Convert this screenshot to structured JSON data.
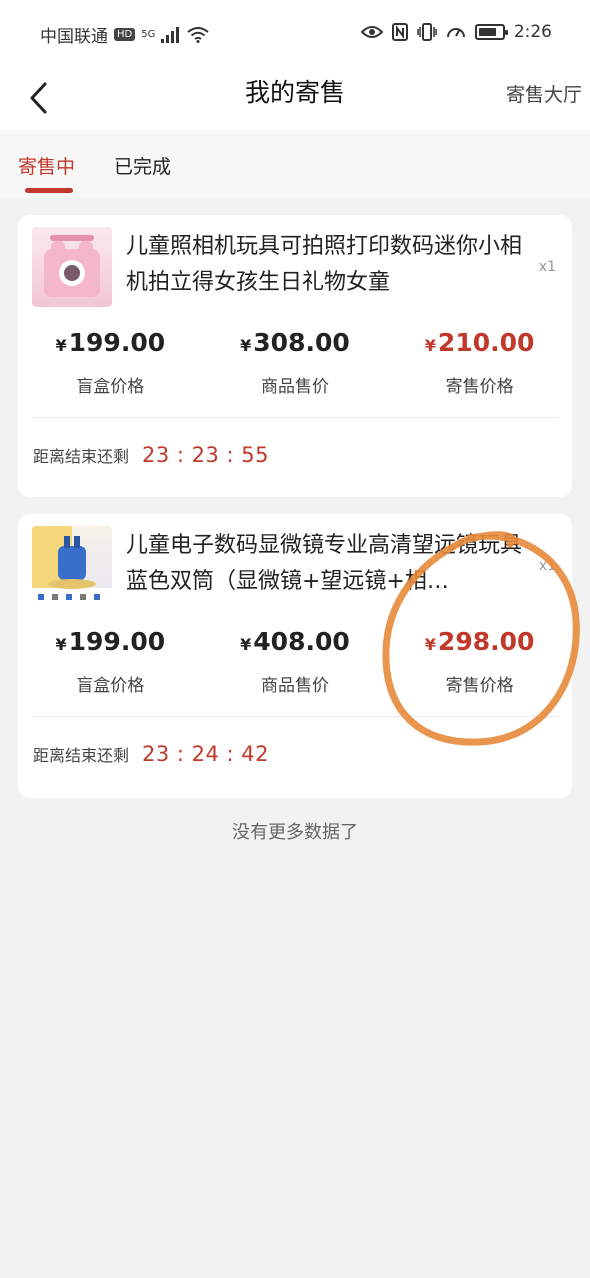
{
  "status_bar": {
    "carrier": "中国联通",
    "hd": "HD",
    "signal": "5G",
    "time": "2:26",
    "battery_level": 0.8,
    "icons": [
      "eye-icon",
      "nfc-icon",
      "vibrate-icon",
      "speed-icon",
      "battery-icon",
      "wifi-icon",
      "signal-icon"
    ]
  },
  "nav": {
    "back_icon": "back-arrow-icon",
    "title": "我的寄售",
    "right_link": "寄售大厅"
  },
  "tabs": [
    {
      "label": "寄售中",
      "active": true
    },
    {
      "label": "已完成",
      "active": false
    }
  ],
  "colors": {
    "accent": "#c0392b",
    "annotation_circle": "#e8893a"
  },
  "items": [
    {
      "title": "儿童照相机玩具可拍照打印数码迷你小相机拍立得女孩生日礼物女童",
      "quantity": "x1",
      "blind_box_price": "199.00",
      "blind_box_label": "盲盒价格",
      "product_price": "308.00",
      "product_label": "商品售价",
      "consign_price": "210.00",
      "consign_label": "寄售价格",
      "countdown_label": "距离结束还剩",
      "countdown": "23 : 23 : 55"
    },
    {
      "title": "儿童电子数码显微镜专业高清望远镜玩具 蓝色双筒（显微镜+望远镜+相…",
      "quantity": "x1",
      "blind_box_price": "199.00",
      "blind_box_label": "盲盒价格",
      "product_price": "408.00",
      "product_label": "商品售价",
      "consign_price": "298.00",
      "consign_label": "寄售价格",
      "countdown_label": "距离结束还剩",
      "countdown": "23 : 24 : 42"
    }
  ],
  "currency": "¥",
  "footer": "没有更多数据了"
}
